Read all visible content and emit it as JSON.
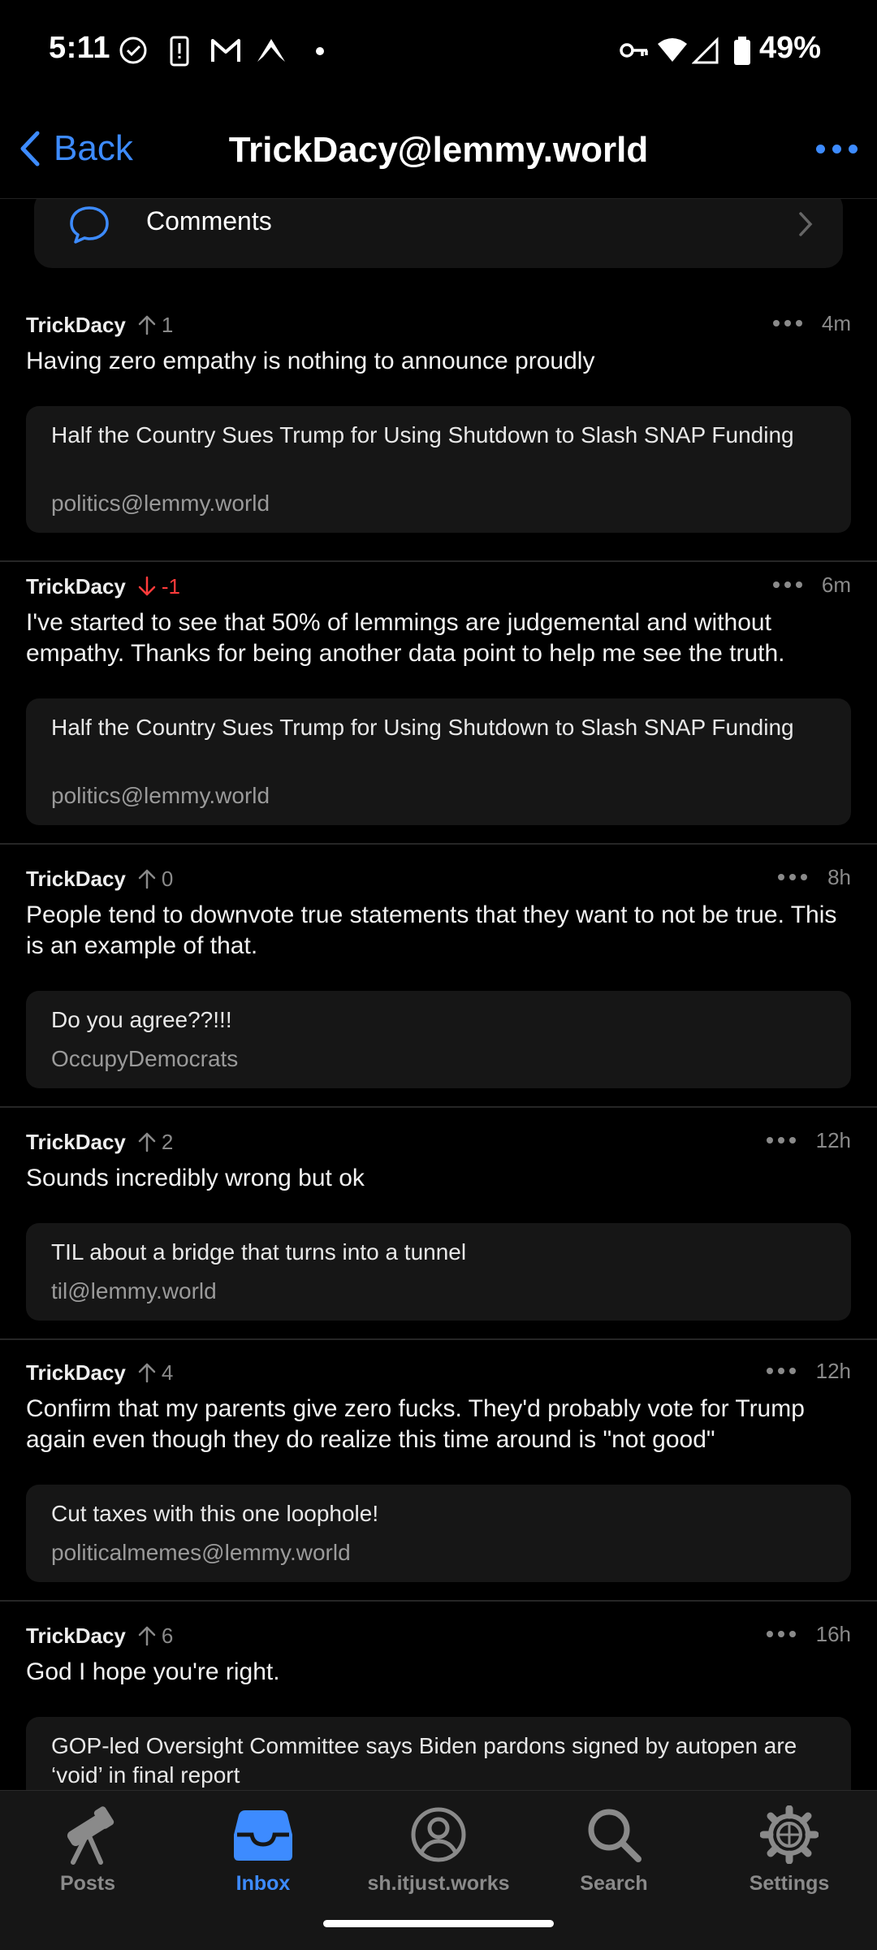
{
  "status_bar": {
    "time": "5:11",
    "battery": "49%"
  },
  "header": {
    "back_label": "Back",
    "title": "TrickDacy@lemmy.world"
  },
  "comments_row": {
    "label": "Comments"
  },
  "items": [
    {
      "user": "TrickDacy",
      "score": "1",
      "vote": "up",
      "age": "4m",
      "body": "Having zero empathy is nothing to announce proudly",
      "post_title": "Half the Country Sues Trump for Using Shutdown to Slash SNAP Funding",
      "community": "politics@lemmy.world"
    },
    {
      "user": "TrickDacy",
      "score": "-1",
      "vote": "down",
      "age": "6m",
      "body": "I've started to see that 50% of lemmings are judgemental and without empathy. Thanks for being another data point to help me see the truth.",
      "post_title": "Half the Country Sues Trump for Using Shutdown to Slash SNAP Funding",
      "community": "politics@lemmy.world"
    },
    {
      "user": "TrickDacy",
      "score": "0",
      "vote": "up",
      "age": "8h",
      "body": "People tend to downvote true statements that they want to not be true. This is an example of that.",
      "post_title": "Do you agree??!!!",
      "community": "OccupyDemocrats"
    },
    {
      "user": "TrickDacy",
      "score": "2",
      "vote": "up",
      "age": "12h",
      "body": "Sounds incredibly wrong but ok",
      "post_title": "TIL about a bridge that turns into a tunnel",
      "community": "til@lemmy.world"
    },
    {
      "user": "TrickDacy",
      "score": "4",
      "vote": "up",
      "age": "12h",
      "body": "Confirm that my parents give zero fucks. They'd probably vote for Trump again even though they do realize this time around is \"not good\"",
      "post_title": "Cut taxes with this one loophole!",
      "community": "politicalmemes@lemmy.world"
    },
    {
      "user": "TrickDacy",
      "score": "6",
      "vote": "up",
      "age": "16h",
      "body": "God I hope you're right.",
      "post_title": "GOP-led Oversight Committee says Biden pardons signed by autopen are ‘void’ in final report",
      "community": ""
    }
  ],
  "tabs": [
    {
      "label": "Posts",
      "icon": "telescope-icon"
    },
    {
      "label": "Inbox",
      "icon": "inbox-tray-icon",
      "active": true
    },
    {
      "label": "sh.itjust.works",
      "icon": "account-icon"
    },
    {
      "label": "Search",
      "icon": "search-icon"
    },
    {
      "label": "Settings",
      "icon": "gear-icon"
    }
  ],
  "colors": {
    "accent": "#3d8bff",
    "downvote": "#ff3b3b",
    "background": "#000000",
    "card": "#161616"
  }
}
